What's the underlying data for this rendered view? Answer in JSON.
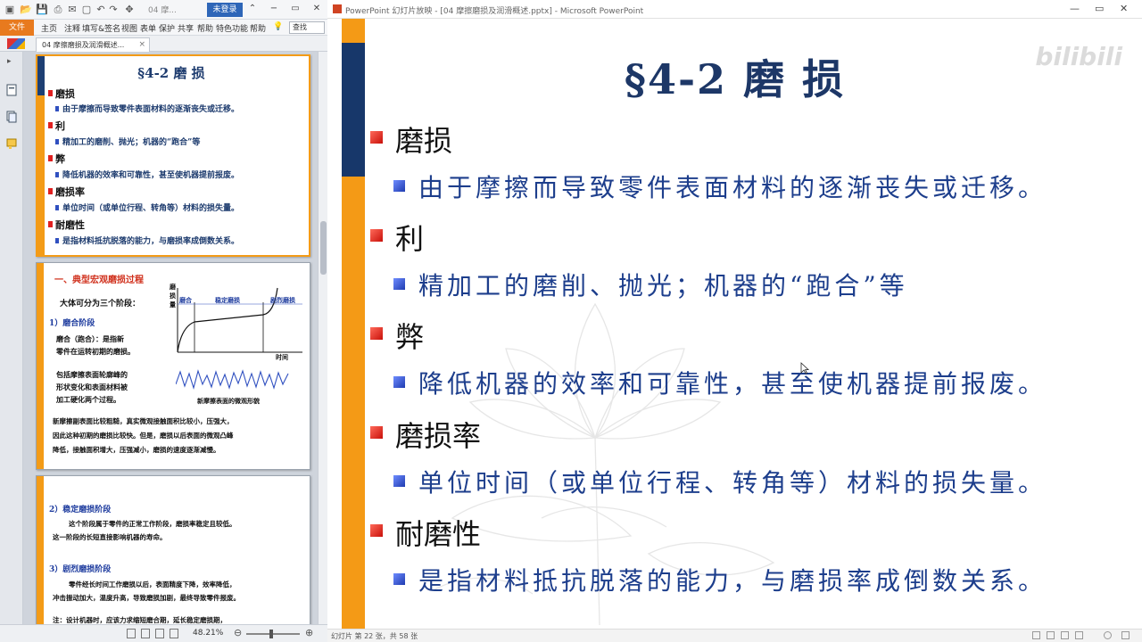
{
  "pdf": {
    "title_fragment": "04 摩...",
    "login_label": "未登录",
    "menu": {
      "file": "文件",
      "items": [
        "主页",
        "注释",
        "填写&签名",
        "视图",
        "表单",
        "保护",
        "共享",
        "帮助",
        "特色功能",
        "帮助"
      ],
      "search_placeholder": "查找"
    },
    "tab": {
      "label": "04 摩擦磨损及润滑概述...",
      "close": "×"
    },
    "thumb1": {
      "title": "§4-2  磨 损",
      "items": [
        {
          "h": "磨损",
          "s": "由于摩擦而导致零件表面材料的逐渐丧失或迁移。"
        },
        {
          "h": "利",
          "s": "精加工的磨削、抛光；机器的“跑合”等"
        },
        {
          "h": "弊",
          "s": "降低机器的效率和可靠性，甚至使机器提前报废。"
        },
        {
          "h": "磨损率",
          "s": "单位时间（或单位行程、转角等）材料的损失量。"
        },
        {
          "h": "耐磨性",
          "s": "是指材料抵抗脱落的能力，与磨损率成倒数关系。"
        }
      ]
    },
    "thumb2": {
      "heading": "一、典型宏观磨损过程",
      "intro": "大体可分为三个阶段：",
      "stage1": "1）磨合阶段",
      "p1a": "磨合（跑合）：是指新",
      "p1b": "零件在运转初期的磨损。",
      "p2a": "包括摩擦表面轮廓峰的",
      "p2b": "形状变化和表面材料被",
      "p2c": "加工硬化两个过程。",
      "curve_caption": "新摩擦表面的微观形貌",
      "ylabel_1": "磨",
      "ylabel_2": "损",
      "ylabel_3": "量",
      "region_1": "磨合",
      "region_2": "稳定磨损",
      "region_3": "剧烈磨损",
      "xlabel": "时间",
      "p3a": "新摩擦副表面比较粗糙，真实微观接触面积比较小，压强大，",
      "p3b": "因此这种初期的磨损比较快。但是，磨损以后表面的微观凸峰",
      "p3c": "降低，接触面积增大，压强减小，磨损的速度逐渐减慢。"
    },
    "thumb3": {
      "stage2": "2）稳定磨损阶段",
      "p1a": "这个阶段属于零件的正常工作阶段，磨损率稳定且较低。",
      "p1b": "这一阶段的长短直接影响机器的寿命。",
      "stage3": "3）剧烈磨损阶段",
      "p2a": "零件经长时间工作磨损以后，表面精度下降，效率降低，",
      "p2b": "冲击振动加大，温度升高，导致磨损加剧，最终导致零件报废。",
      "p3": "注：设计机器时，应该力求缩短磨合期，延长稳定磨损期，"
    },
    "zoom": "48.21%"
  },
  "ppt": {
    "window_title": "PowerPoint 幻灯片放映 - [04 摩擦磨损及润滑概述.pptx] - Microsoft PowerPoint",
    "slide": {
      "title": "§4-2  磨 损",
      "items": [
        {
          "h": "磨损",
          "s": "由于摩擦而导致零件表面材料的逐渐丧失或迁移。"
        },
        {
          "h": "利",
          "s": "精加工的磨削、抛光；机器的“跑合”等"
        },
        {
          "h": "弊",
          "s": "降低机器的效率和可靠性，甚至使机器提前报废。"
        },
        {
          "h": "磨损率",
          "s": "单位时间（或单位行程、转角等）材料的损失量。"
        },
        {
          "h": "耐磨性",
          "s": "是指材料抵抗脱落的能力，与磨损率成倒数关系。"
        }
      ]
    },
    "status": "幻灯片 第 22 张，共 58 张",
    "watermark_logo": "bilibili"
  },
  "colors": {
    "accent_orange": "#f49a16",
    "accent_navy": "#17376a",
    "title_navy": "#1d3767",
    "bullet_blue": "#1d3e8c",
    "bullet_red": "#c8100a"
  }
}
